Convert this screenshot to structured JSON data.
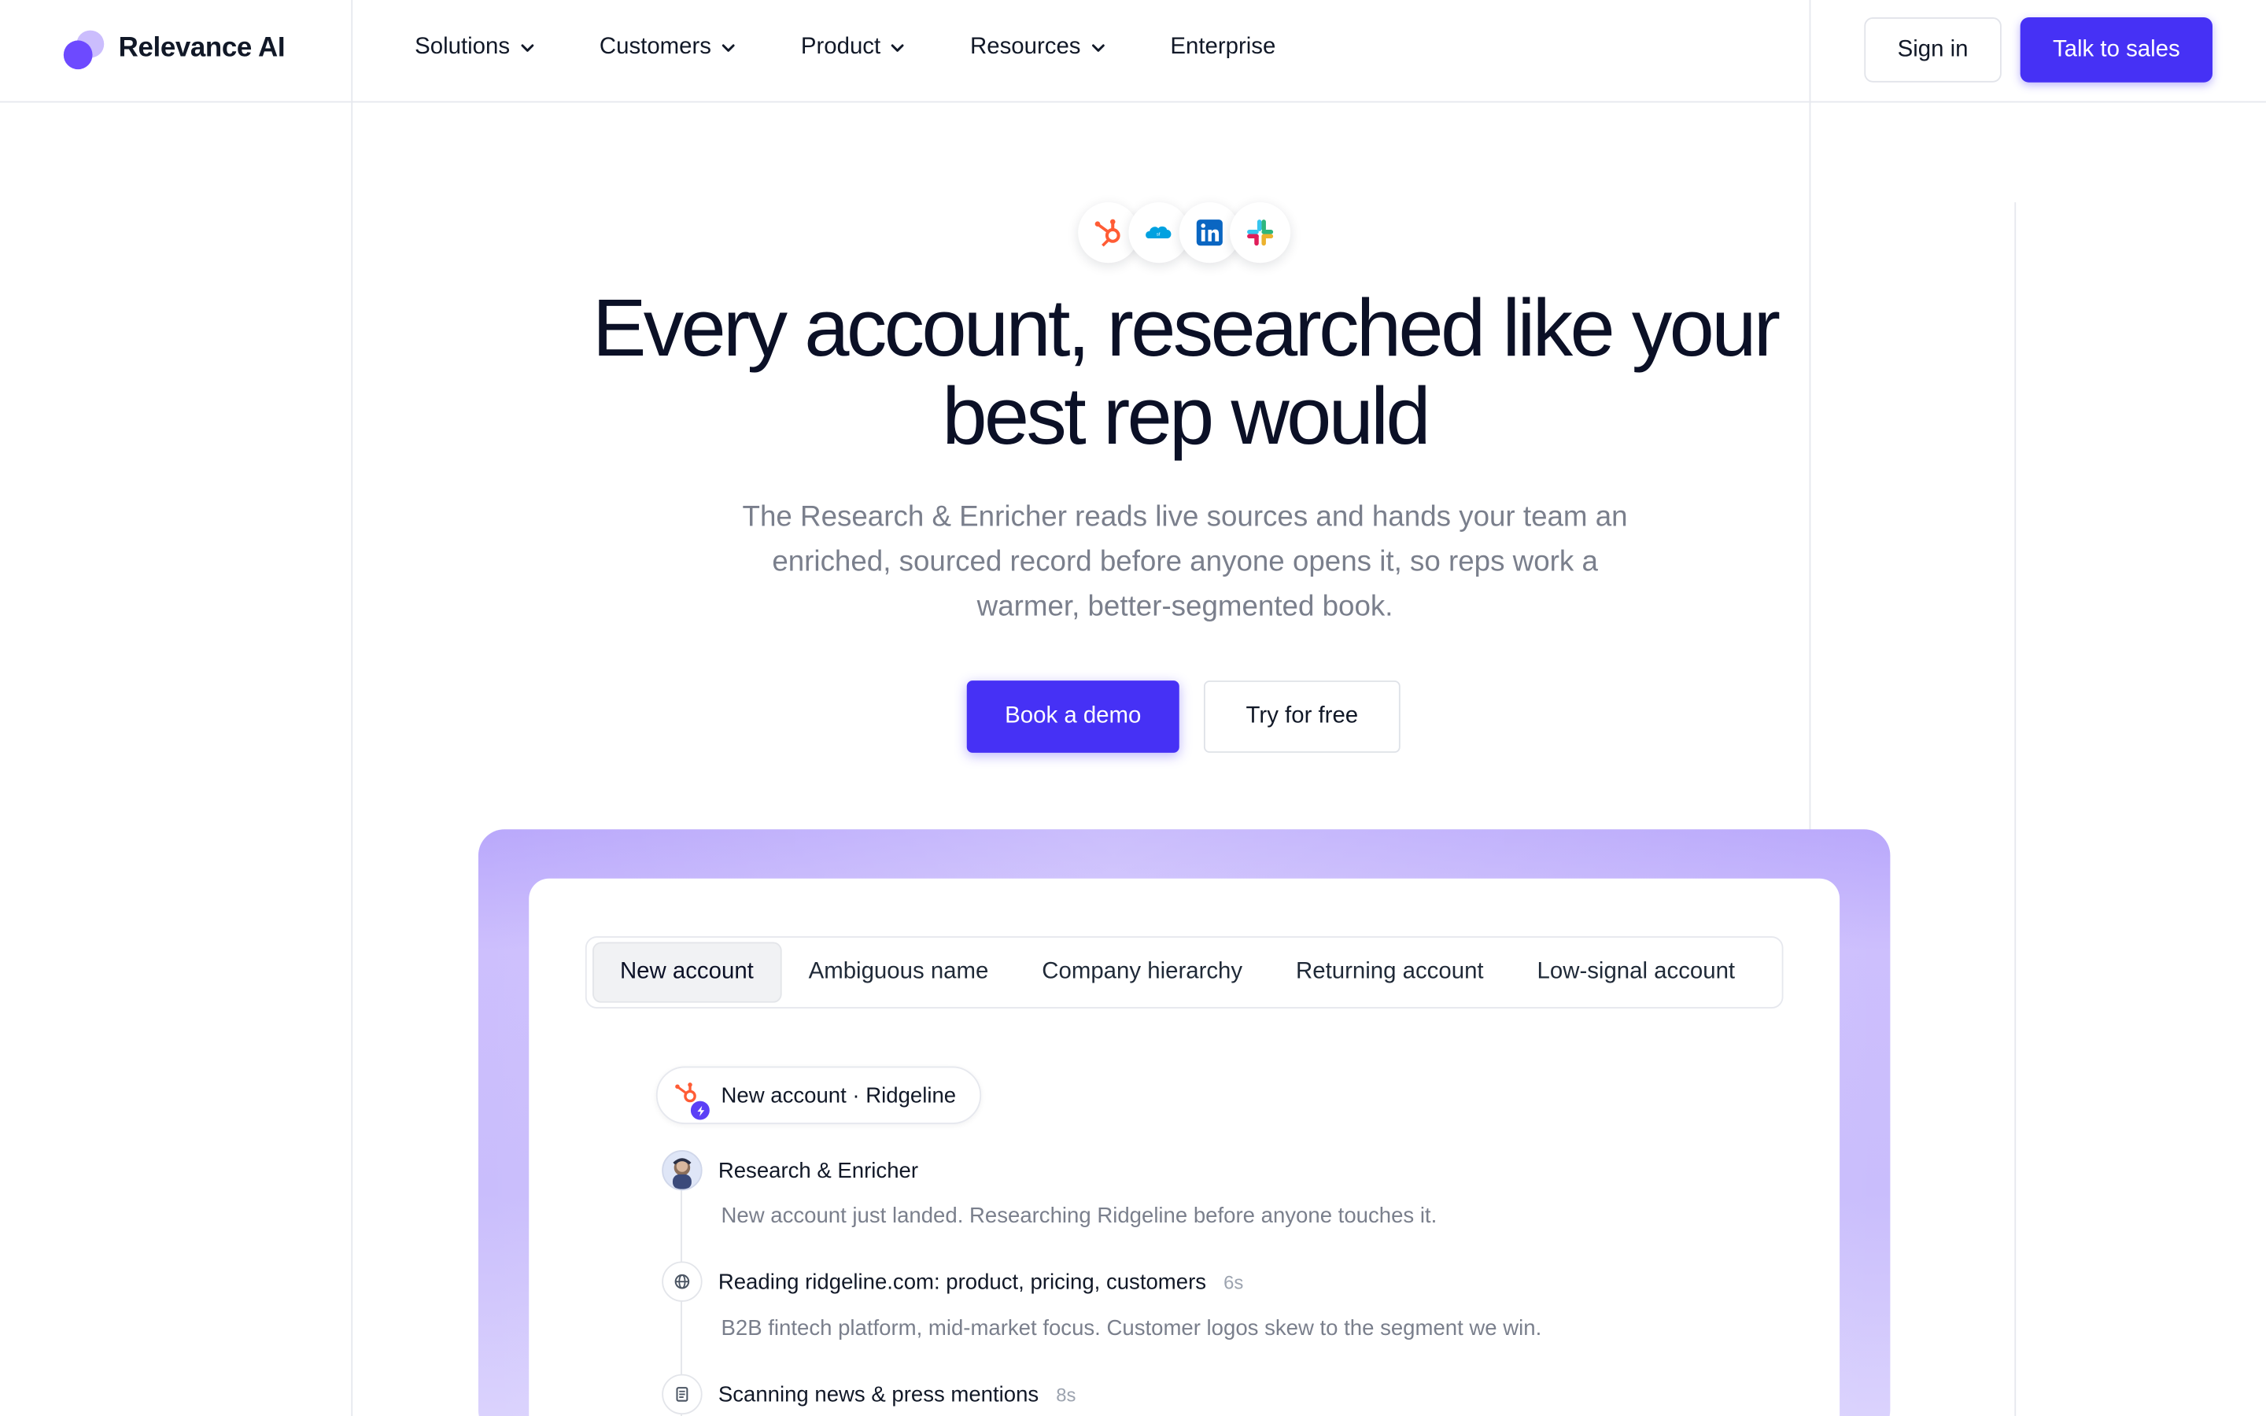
{
  "brand": {
    "name": "Relevance AI"
  },
  "nav": {
    "items": [
      {
        "label": "Solutions",
        "has_menu": true
      },
      {
        "label": "Customers",
        "has_menu": true
      },
      {
        "label": "Product",
        "has_menu": true
      },
      {
        "label": "Resources",
        "has_menu": true
      },
      {
        "label": "Enterprise",
        "has_menu": false
      }
    ],
    "sign_in": "Sign in",
    "talk_to_sales": "Talk to sales"
  },
  "hero": {
    "integrations": [
      "hubspot-icon",
      "salesforce-icon",
      "linkedin-icon",
      "slack-icon"
    ],
    "title": "Every account, researched like your best rep would",
    "subtitle": "The Research & Enricher reads live sources and hands your team an enriched, sourced record before anyone opens it, so reps work a warmer, better-segmented book.",
    "cta_primary": "Book a demo",
    "cta_secondary": "Try for free"
  },
  "demo": {
    "tabs": [
      "New account",
      "Ambiguous name",
      "Company hierarchy",
      "Returning account",
      "Low-signal account"
    ],
    "active_tab": "New account",
    "trigger": "New account · Ridgeline",
    "agent": {
      "name": "Research & Enricher",
      "message": "New account just landed. Researching Ridgeline before anyone touches it."
    },
    "steps": [
      {
        "icon": "globe-icon",
        "title": "Reading ridgeline.com: product, pricing, customers",
        "time": "6s",
        "desc": "B2B fintech platform, mid-market focus. Customer logos skew to the segment we win."
      },
      {
        "icon": "newspaper-icon",
        "title": "Scanning news & press mentions",
        "time": "8s",
        "desc": ""
      }
    ]
  },
  "colors": {
    "accent": "#4631f5",
    "panel": "#c9bdfc",
    "text_muted": "#7a7f8c"
  }
}
